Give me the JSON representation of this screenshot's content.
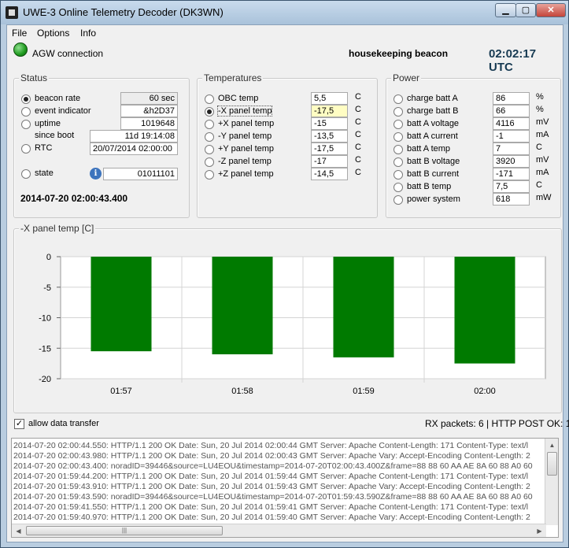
{
  "window": {
    "title": "UWE-3 Online Telemetry Decoder (DK3WN)",
    "minimize": "▁",
    "maximize": "▢",
    "close": "✕"
  },
  "menu": {
    "items": [
      "File",
      "Options",
      "Info"
    ]
  },
  "header": {
    "connection_label": "AGW connection",
    "beacon_type": "housekeeping beacon",
    "utc_time": "02:02:17 UTC",
    "led_color": "#1e9a1e"
  },
  "status": {
    "title": "Status",
    "rows": [
      {
        "label": "beacon rate",
        "value": "60 sec"
      },
      {
        "label": "event indicator",
        "value": "&h2D37"
      },
      {
        "label": "uptime",
        "value": "1019648"
      },
      {
        "label": "since boot",
        "value": "11d 19:14:08"
      },
      {
        "label": "RTC",
        "value": "20/07/2014 02:00:00"
      },
      {
        "label": "state",
        "value": "01011101"
      }
    ],
    "info_icon": "i",
    "datetime": "2014-07-20 02:00:43.400"
  },
  "temperatures": {
    "title": "Temperatures",
    "rows": [
      {
        "label": "OBC temp",
        "value": "5,5",
        "unit": "C"
      },
      {
        "label": "-X panel temp",
        "value": "-17,5",
        "unit": "C"
      },
      {
        "label": "+X panel temp",
        "value": "-15",
        "unit": "C"
      },
      {
        "label": "-Y panel temp",
        "value": "-13,5",
        "unit": "C"
      },
      {
        "label": "+Y panel temp",
        "value": "-17,5",
        "unit": "C"
      },
      {
        "label": "-Z panel temp",
        "value": "-17",
        "unit": "C"
      },
      {
        "label": "+Z panel temp",
        "value": "-14,5",
        "unit": "C"
      }
    ]
  },
  "power": {
    "title": "Power",
    "rows": [
      {
        "label": "charge batt A",
        "value": "86",
        "unit": "%"
      },
      {
        "label": "charge batt B",
        "value": "66",
        "unit": "%"
      },
      {
        "label": "batt A voltage",
        "value": "4116",
        "unit": "mV"
      },
      {
        "label": "batt A current",
        "value": "-1",
        "unit": "mA"
      },
      {
        "label": "batt A temp",
        "value": "7",
        "unit": "C"
      },
      {
        "label": "batt B voltage",
        "value": "3920",
        "unit": "mV"
      },
      {
        "label": "batt B current",
        "value": "-171",
        "unit": "mA"
      },
      {
        "label": "batt B temp",
        "value": "7,5",
        "unit": "C"
      },
      {
        "label": "power system",
        "value": "618",
        "unit": "mW"
      }
    ]
  },
  "chart_data": {
    "type": "bar",
    "title": "-X panel temp [C]",
    "categories": [
      "01:57",
      "01:58",
      "01:59",
      "02:00"
    ],
    "values": [
      -15.5,
      -16,
      -16.5,
      -17.5
    ],
    "ylim": [
      -20,
      0
    ],
    "yticks": [
      "0",
      "-5",
      "-10",
      "-15",
      "-20"
    ],
    "grid": true,
    "bar_color": "#007a00"
  },
  "footer": {
    "allow_transfer_label": "allow data transfer",
    "check_mark": "✓",
    "rx_status": "RX packets: 6 | HTTP POST OK: 12"
  },
  "log": {
    "lines": [
      "2014-07-20 02:00:44.550: HTTP/1.1 200 OK Date: Sun, 20 Jul 2014 02:00:44 GMT Server: Apache Content-Length: 171 Content-Type: text/l",
      "2014-07-20 02:00:43.980: HTTP/1.1 200 OK Date: Sun, 20 Jul 2014 02:00:43 GMT Server: Apache Vary: Accept-Encoding Content-Length: 2",
      "2014-07-20 02:00:43.400: noradID=39446&source=LU4EOU&timestamp=2014-07-20T02:00:43.400Z&frame=88 88 60 AA AE 8A 60 88 A0 60",
      "2014-07-20 01:59:44.200: HTTP/1.1 200 OK Date: Sun, 20 Jul 2014 01:59:44 GMT Server: Apache Content-Length: 171 Content-Type: text/l",
      "2014-07-20 01:59:43.910: HTTP/1.1 200 OK Date: Sun, 20 Jul 2014 01:59:43 GMT Server: Apache Vary: Accept-Encoding Content-Length: 2",
      "2014-07-20 01:59:43.590: noradID=39446&source=LU4EOU&timestamp=2014-07-20T01:59:43.590Z&frame=88 88 60 AA AE 8A 60 88 A0 60",
      "2014-07-20 01:59:41.550: HTTP/1.1 200 OK Date: Sun, 20 Jul 2014 01:59:41 GMT Server: Apache Content-Length: 171 Content-Type: text/l",
      "2014-07-20 01:59:40.970: HTTP/1.1 200 OK Date: Sun, 20 Jul 2014 01:59:40 GMT Server: Apache Vary: Accept-Encoding Content-Length: 2"
    ],
    "scroll_grip": "|||"
  }
}
